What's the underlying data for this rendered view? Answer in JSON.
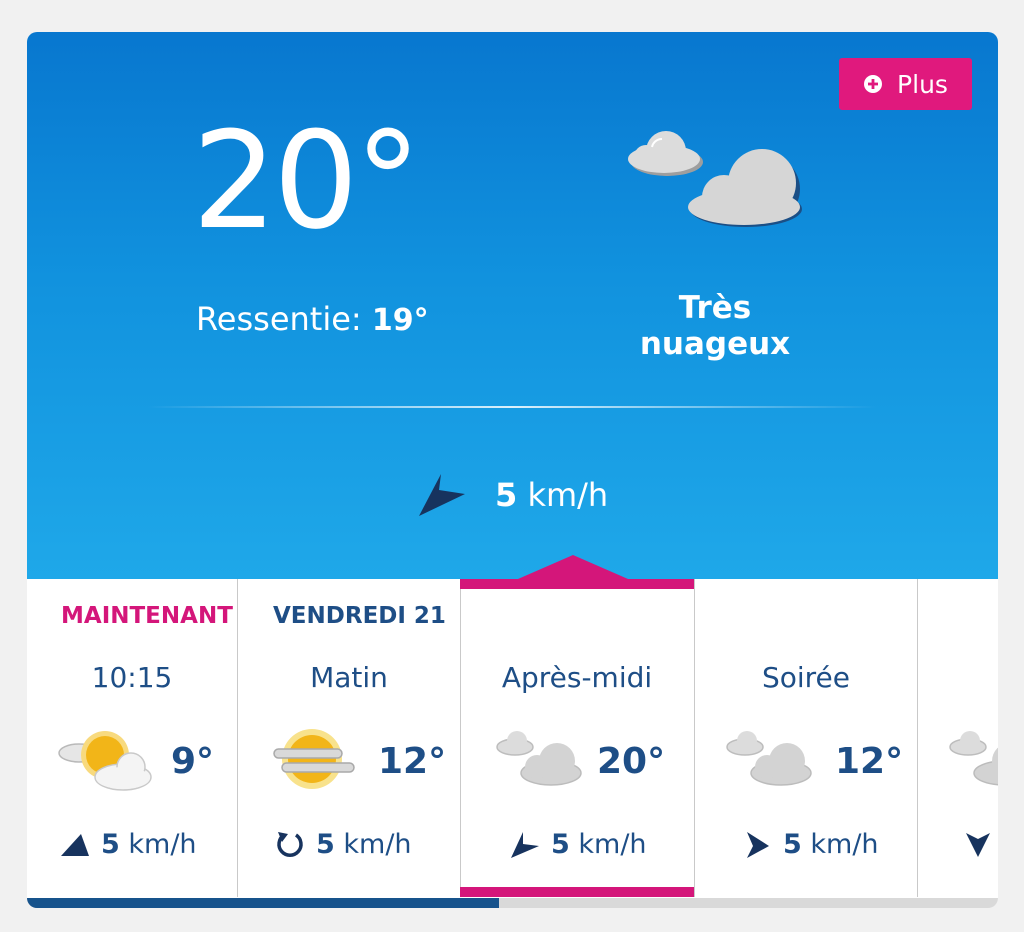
{
  "current": {
    "temperature": "20°",
    "feels_label": "Ressentie:",
    "feels_value": "19°",
    "condition": "Très nuageux",
    "icon": "cloud-icon",
    "wind_speed": "5",
    "wind_unit": "km/h",
    "more_button": "Plus"
  },
  "forecast": [
    {
      "day": "MAINTENANT",
      "time": "10:15",
      "temp": "9°",
      "icon": "sun-cloud-icon",
      "wind_speed": "5",
      "wind_unit": "km/h",
      "wind_icon": "wind-arrow-icon"
    },
    {
      "day": "VENDREDI 21",
      "time": "Matin",
      "temp": "12°",
      "icon": "haze-sun-icon",
      "wind_speed": "5",
      "wind_unit": "km/h",
      "wind_icon": "variable-wind-icon"
    },
    {
      "day": "",
      "time": "Après-midi",
      "temp": "20°",
      "icon": "cloud-icon",
      "wind_speed": "5",
      "wind_unit": "km/h",
      "wind_icon": "wind-arrow-icon"
    },
    {
      "day": "",
      "time": "Soirée",
      "temp": "12°",
      "icon": "cloud-icon",
      "wind_speed": "5",
      "wind_unit": "km/h",
      "wind_icon": "wind-arrow-icon"
    }
  ],
  "colors": {
    "accent": "#d4167a",
    "text_dark": "#1e4e86",
    "hero_top": "#0877cf",
    "hero_bottom": "#1fa8e9"
  },
  "scroll_position": 0.486
}
